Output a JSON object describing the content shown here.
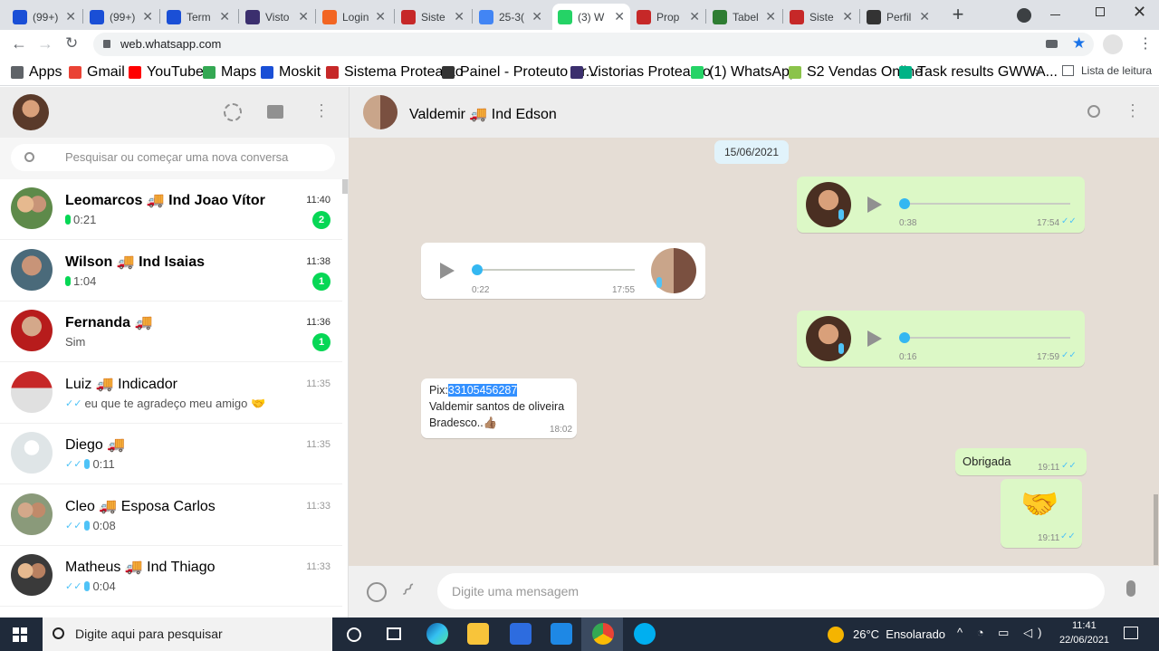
{
  "browser": {
    "tabs": [
      {
        "label": "(99+)",
        "icon": "moskit-icon",
        "color": "#1a4fd6"
      },
      {
        "label": "(99+)",
        "icon": "moskit-icon",
        "color": "#1a4fd6"
      },
      {
        "label": "Term",
        "icon": "moskit-icon",
        "color": "#1a4fd6"
      },
      {
        "label": "Visto",
        "icon": "grid-icon",
        "color": "#3b2f6e"
      },
      {
        "label": "Login",
        "icon": "cp-icon",
        "color": "#f26522"
      },
      {
        "label": "Siste",
        "icon": "shield-icon",
        "color": "#c62828"
      },
      {
        "label": "25-3(",
        "icon": "google-icon",
        "color": "#4285f4"
      },
      {
        "label": "(3) W",
        "icon": "whatsapp-icon",
        "color": "#25d366"
      },
      {
        "label": "Prop",
        "icon": "shield-icon",
        "color": "#c62828"
      },
      {
        "label": "Tabel",
        "icon": "table-icon",
        "color": "#2e7d32"
      },
      {
        "label": "Siste",
        "icon": "shield-icon",
        "color": "#c62828"
      },
      {
        "label": "Perfil",
        "icon": "shield-icon",
        "color": "#333"
      }
    ],
    "url": "web.whatsapp.com",
    "bookmarks": [
      {
        "label": "Apps",
        "icon": "apps-grid-icon",
        "color": "#5f6368"
      },
      {
        "label": "Gmail",
        "icon": "gmail-icon",
        "color": "#ea4335"
      },
      {
        "label": "YouTube",
        "icon": "youtube-icon",
        "color": "#ff0000"
      },
      {
        "label": "Maps",
        "icon": "maps-icon",
        "color": "#34a853"
      },
      {
        "label": "Moskit",
        "icon": "moskit-icon",
        "color": "#1a4fd6"
      },
      {
        "label": "Sistema Proteauto",
        "icon": "shield-icon",
        "color": "#c62828"
      },
      {
        "label": "Painel - Proteuto Br...",
        "icon": "shield-icon",
        "color": "#333"
      },
      {
        "label": "Vistorias Proteauto",
        "icon": "grid-icon",
        "color": "#3b2f6e"
      },
      {
        "label": "(1) WhatsApp",
        "icon": "whatsapp-icon",
        "color": "#25d366"
      },
      {
        "label": "S2 Vendas Online",
        "icon": "s2-icon",
        "color": "#8bc34a"
      },
      {
        "label": "Task results GWWA...",
        "icon": "s-icon",
        "color": "#00b386"
      }
    ],
    "reading_list": "Lista de leitura"
  },
  "whatsapp": {
    "search_placeholder": "Pesquisar ou começar uma nova conversa",
    "chats": [
      {
        "name": "Leomarcos 🚚 Ind Joao Vítor",
        "time": "11:40",
        "preview": "0:21",
        "kind": "audio-green",
        "unread": "2",
        "bold": true
      },
      {
        "name": "Wilson 🚚 Ind Isaias",
        "time": "11:38",
        "preview": "1:04",
        "kind": "audio-green",
        "unread": "1",
        "bold": true
      },
      {
        "name": "Fernanda 🚚",
        "time": "11:36",
        "preview": "Sim",
        "kind": "text",
        "unread": "1",
        "bold": true
      },
      {
        "name": "Luiz 🚚 Indicador",
        "time": "11:35",
        "preview": "eu que te agradeço meu amigo 🤝",
        "kind": "text-read",
        "unread": "",
        "bold": false
      },
      {
        "name": "Diego 🚚",
        "time": "11:35",
        "preview": "0:11",
        "kind": "audio-read",
        "unread": "",
        "bold": false
      },
      {
        "name": "Cleo 🚚 Esposa Carlos",
        "time": "11:33",
        "preview": "0:08",
        "kind": "audio-read",
        "unread": "",
        "bold": false
      },
      {
        "name": "Matheus 🚚 Ind Thiago",
        "time": "11:33",
        "preview": "0:04",
        "kind": "audio-read",
        "unread": "",
        "bold": false
      }
    ],
    "contact_name": "Valdemir 🚚 Ind Edson",
    "date_chip": "15/06/2021",
    "messages": {
      "audio1": {
        "duration": "0:38",
        "time": "17:54"
      },
      "audio2": {
        "duration": "0:22",
        "time": "17:55"
      },
      "audio3": {
        "duration": "0:16",
        "time": "17:59"
      },
      "text1": {
        "prefix": "Pix:",
        "highlight": "33105456287",
        "line2": "Valdemir santos de oliveira",
        "line3": "Bradesco..👍🏽",
        "time": "18:02"
      },
      "text2": {
        "text": "Obrigada",
        "time": "19:11"
      },
      "sticker": {
        "emoji": "🤝",
        "time": "19:11"
      }
    },
    "input_placeholder": "Digite uma mensagem"
  },
  "taskbar": {
    "search_placeholder": "Digite aqui para pesquisar",
    "weather": "26°C  Ensolarado",
    "time": "11:41",
    "date": "22/06/2021"
  }
}
